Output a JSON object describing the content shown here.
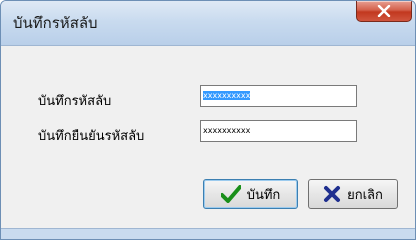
{
  "window": {
    "title": "บันทึกรหัสลับ"
  },
  "form": {
    "password_label": "บันทึกรหัสลับ",
    "password_value": "xxxxxxxxxx",
    "confirm_label": "บันทึกยืนยันรหัสลับ",
    "confirm_value": "xxxxxxxxxx"
  },
  "buttons": {
    "save_label": "บันทึก",
    "cancel_label": "ยกเลิก"
  },
  "colors": {
    "save_check": "#1a8f1a",
    "cancel_x": "#1f2f8f",
    "selection": "#3399ff",
    "close_button": "#c2381f"
  },
  "icons": {
    "close": "close-icon",
    "save": "checkmark-icon",
    "cancel": "x-mark-icon"
  }
}
